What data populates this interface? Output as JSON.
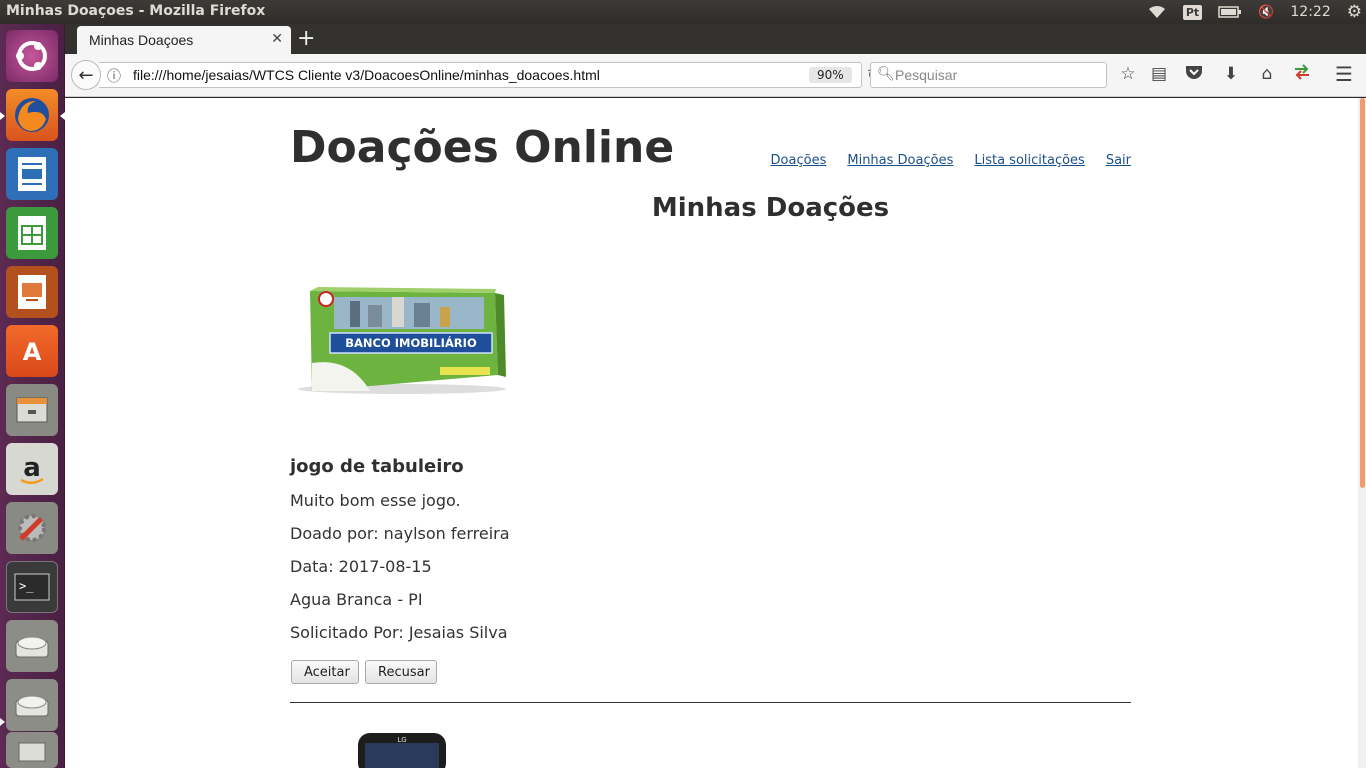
{
  "os": {
    "window_title": "Minhas Doaçoes - Mozilla Firefox",
    "lang_indicator": "Pt",
    "clock": "12:22"
  },
  "browser": {
    "tab_title": "Minhas Doaçoes",
    "url": "file:///home/jesaias/WTCS Cliente v3/DoacoesOnline/minhas_doacoes.html",
    "zoom": "90%",
    "search_placeholder": "Pesquisar"
  },
  "page": {
    "site_title": "Doações Online",
    "nav": [
      "Doações",
      "Minhas Doações",
      "Lista solicitações",
      "Sair"
    ],
    "heading": "Minhas Doações",
    "donation": {
      "image_label": "BANCO IMOBILIÁRIO",
      "title": "jogo de tabuleiro",
      "description": "Muito bom esse jogo.",
      "donated_by": "Doado por: naylson ferreira",
      "date": "Data: 2017-08-15",
      "location": "Agua Branca - PI",
      "requested_by": "Solicitado Por: Jesaias Silva",
      "accept_label": "Aceitar",
      "reject_label": "Recusar"
    },
    "next_item_image_label": "LG"
  }
}
